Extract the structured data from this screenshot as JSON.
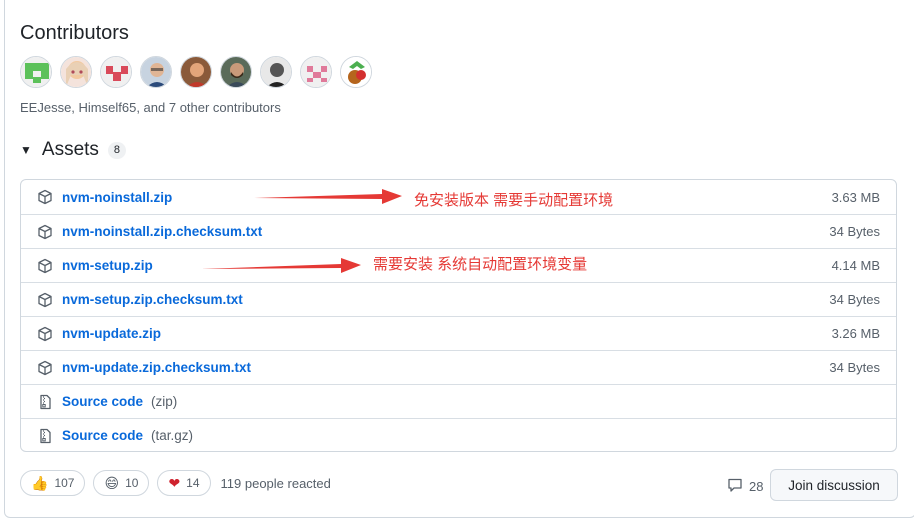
{
  "contributors": {
    "title": "Contributors",
    "summary": "EEJesse, Himself65, and 7 other contributors",
    "avatars": [
      "identicon-green",
      "anime-girl",
      "identicon-red",
      "person-glasses",
      "person-red-shirt",
      "person-beard",
      "person-dark",
      "identicon-pink",
      "mascot-fox"
    ]
  },
  "assets": {
    "title": "Assets",
    "count": "8",
    "items": [
      {
        "name": "nvm-noinstall.zip",
        "size": "3.63 MB",
        "icon": "package-icon"
      },
      {
        "name": "nvm-noinstall.zip.checksum.txt",
        "size": "34 Bytes",
        "icon": "package-icon"
      },
      {
        "name": "nvm-setup.zip",
        "size": "4.14 MB",
        "icon": "package-icon"
      },
      {
        "name": "nvm-setup.zip.checksum.txt",
        "size": "34 Bytes",
        "icon": "package-icon"
      },
      {
        "name": "nvm-update.zip",
        "size": "3.26 MB",
        "icon": "package-icon"
      },
      {
        "name": "nvm-update.zip.checksum.txt",
        "size": "34 Bytes",
        "icon": "package-icon"
      }
    ],
    "source": [
      {
        "label": "Source code",
        "ext": "(zip)",
        "icon": "file-zip-icon"
      },
      {
        "label": "Source code",
        "ext": "(tar.gz)",
        "icon": "file-zip-icon"
      }
    ]
  },
  "annotations": {
    "noinstall": "免安装版本 需要手动配置环境",
    "setup": "需要安装 系统自动配置环境变量",
    "color": "#e53935"
  },
  "reactions": {
    "thumbs_up": "107",
    "smile": "10",
    "heart": "14",
    "summary": "119 people reacted"
  },
  "discussion": {
    "comments": "28",
    "join_label": "Join discussion"
  },
  "colors": {
    "link": "#0969da",
    "muted": "#57606a",
    "border": "#d0d7de"
  }
}
